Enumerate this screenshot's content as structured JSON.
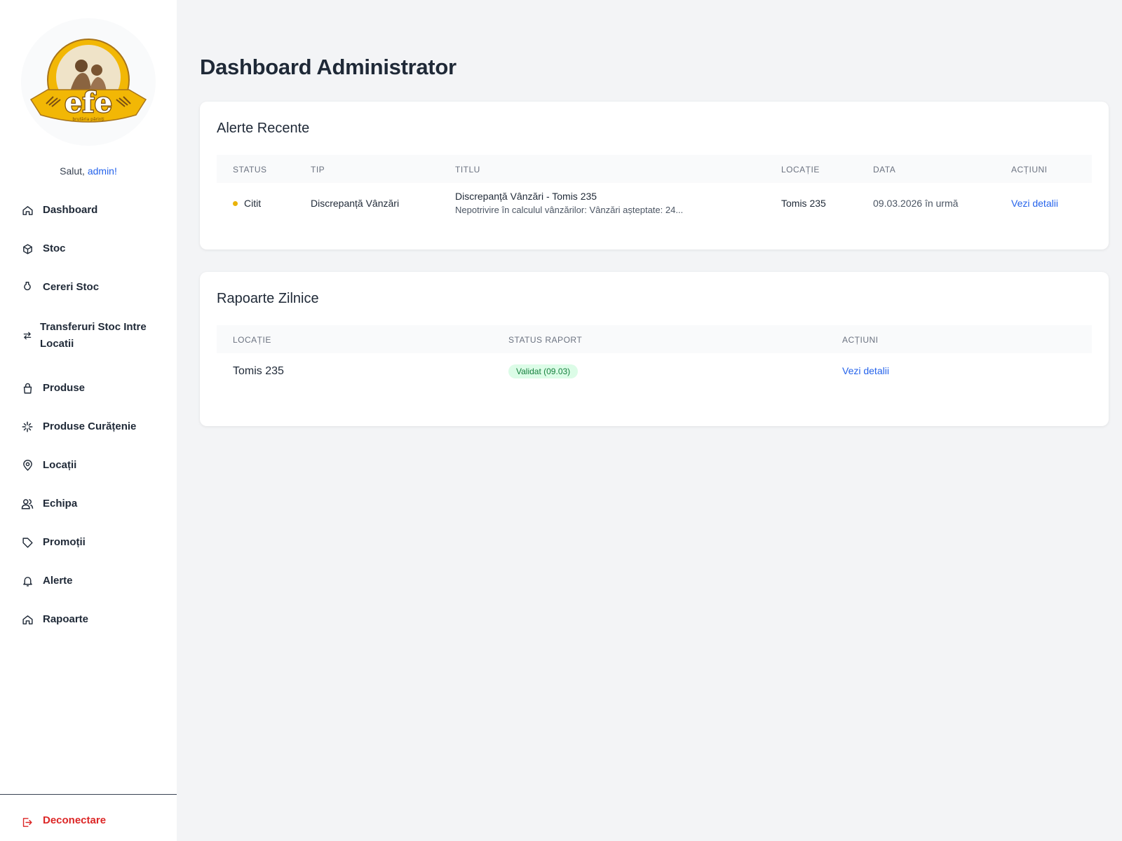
{
  "sidebar": {
    "logo": {
      "brand": "efe",
      "tagline": "brutăria părinți"
    },
    "greeting": "Salut, ",
    "user": "admin!",
    "items": [
      {
        "label": "Dashboard",
        "icon": "home-icon"
      },
      {
        "label": "Stoc",
        "icon": "box-icon"
      },
      {
        "label": "Cereri Stoc",
        "icon": "flask-icon"
      },
      {
        "label": "Transferuri Stoc Intre Locatii",
        "icon": "transfer-icon"
      },
      {
        "label": "Produse",
        "icon": "shopping-bag-icon"
      },
      {
        "label": "Produse Curățenie",
        "icon": "sparkles-icon"
      },
      {
        "label": "Locații",
        "icon": "map-pin-icon"
      },
      {
        "label": "Echipa",
        "icon": "users-icon"
      },
      {
        "label": "Promoții",
        "icon": "tag-icon"
      },
      {
        "label": "Alerte",
        "icon": "bell-icon"
      },
      {
        "label": "Rapoarte",
        "icon": "home-icon"
      }
    ],
    "logout_label": "Deconectare",
    "colors": {
      "accent": "#2563eb",
      "danger": "#dc2626"
    }
  },
  "main": {
    "title": "Dashboard Administrator",
    "alerts": {
      "title": "Alerte Recente",
      "columns": [
        "STATUS",
        "TIP",
        "TITLU",
        "LOCAȚIE",
        "DATA",
        "ACȚIUNI"
      ],
      "rows": [
        {
          "status": "Citit",
          "type": "Discrepanță Vânzări",
          "title": "Discrepanță Vânzări - Tomis 235",
          "subtitle": "Nepotrivire în calculul vânzărilor: Vânzări așteptate: 24...",
          "location": "Tomis 235",
          "date": "09.03.2026 în urmă",
          "action": "Vezi detalii",
          "status_color": "#eab308"
        }
      ]
    },
    "reports": {
      "title": "Rapoarte Zilnice",
      "columns": [
        "LOCAȚIE",
        "STATUS RAPORT",
        "ACȚIUNI"
      ],
      "rows": [
        {
          "location": "Tomis 235",
          "status": "Validat (09.03)",
          "action": "Vezi detalii",
          "status_color": "#15803d"
        }
      ]
    }
  }
}
